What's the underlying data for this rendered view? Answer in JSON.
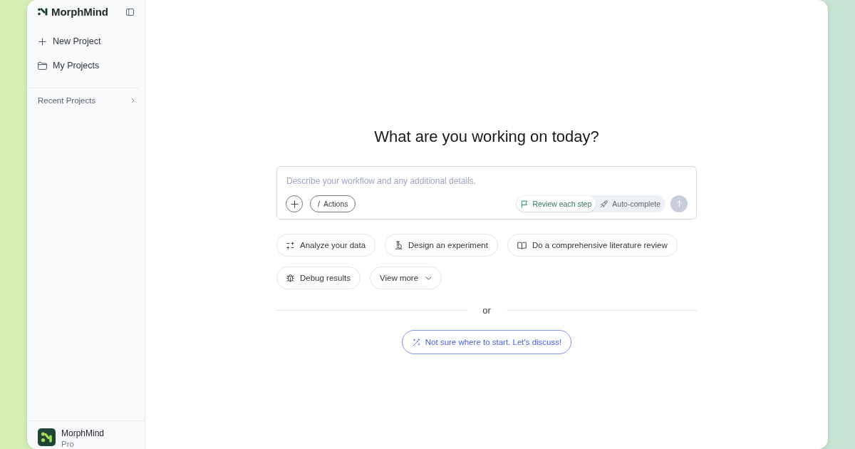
{
  "sidebar": {
    "brand": "MorphMind",
    "nav": [
      {
        "kind": "add",
        "label": "New Project"
      },
      {
        "kind": "folder",
        "label": "My Projects"
      }
    ],
    "recent": {
      "label": "Recent Projects",
      "expanded": false
    },
    "account": {
      "name": "MorphMind",
      "plan": "Pro"
    }
  },
  "main": {
    "heading": "What are you working on today?",
    "composer": {
      "placeholder": "Describe your workflow and any additional details.",
      "actions": {
        "key": "/",
        "label": "Actions"
      },
      "modes": [
        {
          "kind": "flag",
          "label": "Review each step",
          "selected": true
        },
        {
          "kind": "rocket",
          "label": "Auto-complete",
          "selected": false
        }
      ],
      "send": {
        "disabled": true
      }
    },
    "suggestions": [
      {
        "kind": "analyze",
        "label": "Analyze your data"
      },
      {
        "kind": "experiment",
        "label": "Design an experiment"
      },
      {
        "kind": "literature",
        "label": "Do a comprehensive literature review"
      },
      {
        "kind": "debug",
        "label": "Debug results"
      },
      {
        "kind": "more",
        "label": "View more"
      }
    ],
    "divider": "or",
    "discuss": "Not sure where to start. Let's discuss!"
  }
}
